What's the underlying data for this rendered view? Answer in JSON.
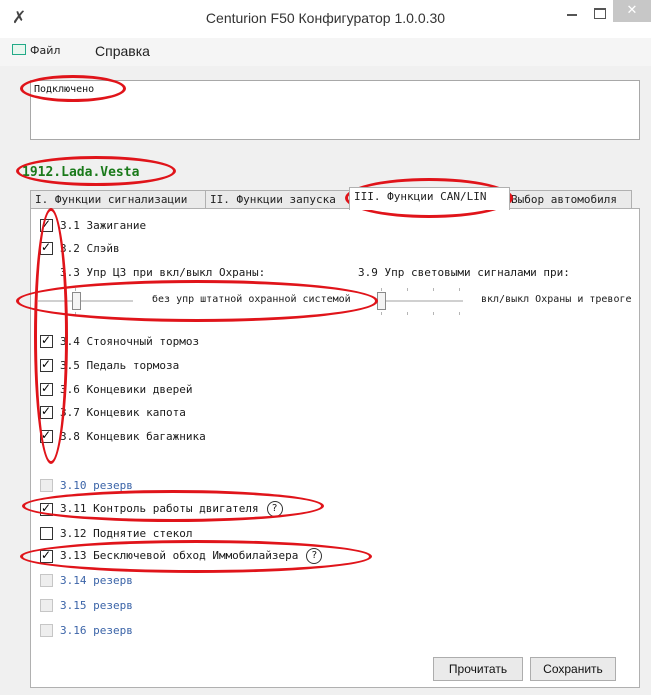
{
  "window": {
    "title": "Centurion F50 Конфигуратор 1.0.0.30",
    "close_glyph": "✕"
  },
  "menu": {
    "file": "Файл",
    "help": "Справка"
  },
  "log": {
    "text": "Подключено"
  },
  "model": "1912.Lada.Vesta",
  "tabs": [
    {
      "label": "I. Функции сигнализации",
      "active": false
    },
    {
      "label": "II. Функции запуска",
      "active": false
    },
    {
      "label": "III. Функции CAN/LIN",
      "active": true
    },
    {
      "label": "Выбор автомобиля",
      "active": false
    }
  ],
  "options": [
    {
      "id": "3.1",
      "label": "3.1  Зажигание",
      "checked": true,
      "enabled": true
    },
    {
      "id": "3.2",
      "label": "3.2  Слэйв",
      "checked": true,
      "enabled": true
    },
    {
      "id": "3.4",
      "label": "3.4  Стояночный тормоз",
      "checked": true,
      "enabled": true
    },
    {
      "id": "3.5",
      "label": "3.5  Педаль тормоза",
      "checked": true,
      "enabled": true
    },
    {
      "id": "3.6",
      "label": "3.6  Концевики дверей",
      "checked": true,
      "enabled": true
    },
    {
      "id": "3.7",
      "label": "3.7  Концевик капота",
      "checked": true,
      "enabled": true
    },
    {
      "id": "3.8",
      "label": "3.8  Концевик багажника",
      "checked": true,
      "enabled": true
    },
    {
      "id": "3.10",
      "label": "3.10 резерв",
      "checked": false,
      "enabled": false
    },
    {
      "id": "3.11",
      "label": "3.11 Контроль работы двигателя",
      "checked": true,
      "enabled": true,
      "help": "?"
    },
    {
      "id": "3.12",
      "label": "3.12 Поднятие стекол",
      "checked": false,
      "enabled": true
    },
    {
      "id": "3.13",
      "label": "3.13 Бесключевой обход Иммобилайзера",
      "checked": true,
      "enabled": true,
      "help": "?"
    },
    {
      "id": "3.14",
      "label": "3.14 резерв",
      "checked": false,
      "enabled": false
    },
    {
      "id": "3.15",
      "label": "3.15 резерв",
      "checked": false,
      "enabled": false
    },
    {
      "id": "3.16",
      "label": "3.16 резерв",
      "checked": false,
      "enabled": false
    }
  ],
  "sliders": {
    "central_lock": {
      "label": "3.3  Упр ЦЗ при вкл/выкл Охраны:",
      "value_text": "без упр штатной охранной системой"
    },
    "lights": {
      "label": "3.9 Упр световыми сигналами при:",
      "value_text": "вкл/выкл Охраны и тревоге"
    }
  },
  "buttons": {
    "read": "Прочитать",
    "save": "Сохранить"
  },
  "colors": {
    "model_text": "#1a7a1a",
    "reserve_text": "#3b64a8",
    "annotation": "#e0141a"
  }
}
